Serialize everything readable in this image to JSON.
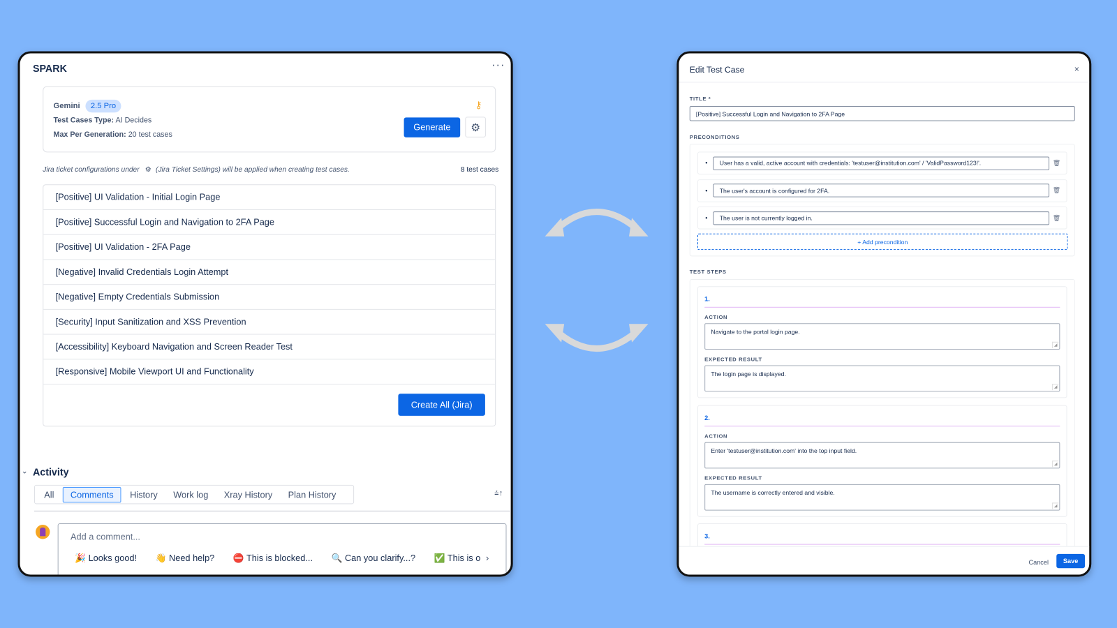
{
  "left": {
    "app_title": "SPARK",
    "config": {
      "model_label": "Gemini",
      "model_badge": "2.5 Pro",
      "type_label": "Test Cases Type:",
      "type_value": "AI Decides",
      "max_label": "Max Per Generation:",
      "max_value": "20 test cases",
      "generate_label": "Generate"
    },
    "notice": {
      "prefix": "Jira ticket configurations under",
      "suffix": "(Jira Ticket Settings) will be applied when creating test cases.",
      "count": "8 test cases"
    },
    "test_cases": [
      "[Positive] UI Validation - Initial Login Page",
      "[Positive] Successful Login and Navigation to 2FA Page",
      "[Positive] UI Validation - 2FA Page",
      "[Negative] Invalid Credentials Login Attempt",
      "[Negative] Empty Credentials Submission",
      "[Security] Input Sanitization and XSS Prevention",
      "[Accessibility] Keyboard Navigation and Screen Reader Test",
      "[Responsive] Mobile Viewport UI and Functionality"
    ],
    "create_all_label": "Create All (Jira)",
    "activity": {
      "title": "Activity",
      "tabs": [
        "All",
        "Comments",
        "History",
        "Work log",
        "Xray History",
        "Plan History"
      ],
      "active_tab": "Comments",
      "comment_placeholder": "Add a comment...",
      "quick_replies": [
        "🎉 Looks good!",
        "👋 Need help?",
        "⛔ This is blocked...",
        "🔍 Can you clarify...?",
        "✅ This is o"
      ]
    }
  },
  "right": {
    "title": "Edit Test Case",
    "title_label": "TITLE *",
    "title_value": "[Positive] Successful Login and Navigation to 2FA Page",
    "preconditions_label": "PRECONDITIONS",
    "preconditions": [
      "User has a valid, active account with credentials: 'testuser@institution.com' / 'ValidPassword123!'.",
      "The user's account is configured for 2FA.",
      "The user is not currently logged in."
    ],
    "add_precondition": "+ Add precondition",
    "steps_label": "TEST STEPS",
    "action_label": "ACTION",
    "expected_label": "EXPECTED RESULT",
    "steps": [
      {
        "num": "1.",
        "action": "Navigate to the portal login page.",
        "expected": "The login page is displayed."
      },
      {
        "num": "2.",
        "action": "Enter 'testuser@institution.com' into the top input field.",
        "expected": "The username is correctly entered and visible."
      },
      {
        "num": "3."
      }
    ],
    "cancel_label": "Cancel",
    "save_label": "Save"
  },
  "colors": {
    "background": "#7fb5fb",
    "primary": "#0c66e4",
    "arrows": "#d9d9d9"
  }
}
